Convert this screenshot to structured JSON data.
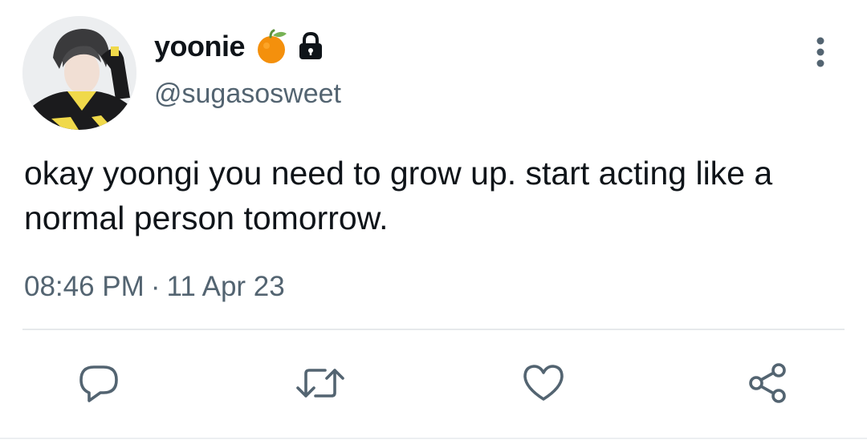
{
  "author": {
    "display_name": "yoonie",
    "name_emoji": "tangerine-emoji",
    "lock_icon": "lock-icon",
    "handle": "@sugasosweet"
  },
  "tweet": {
    "text": "okay yoongi you need to grow up. start acting like a normal person tomorrow.",
    "time": "08:46 PM",
    "separator": "·",
    "date": "11 Apr 23"
  },
  "actions": [
    {
      "icon": "reply-icon"
    },
    {
      "icon": "retweet-icon"
    },
    {
      "icon": "like-icon"
    },
    {
      "icon": "share-icon"
    }
  ],
  "colors": {
    "text": "#0f1419",
    "secondary": "#536471",
    "divider": "#e6e9eb",
    "emoji_orange": "#f4900c",
    "emoji_leaf": "#5c913b"
  }
}
